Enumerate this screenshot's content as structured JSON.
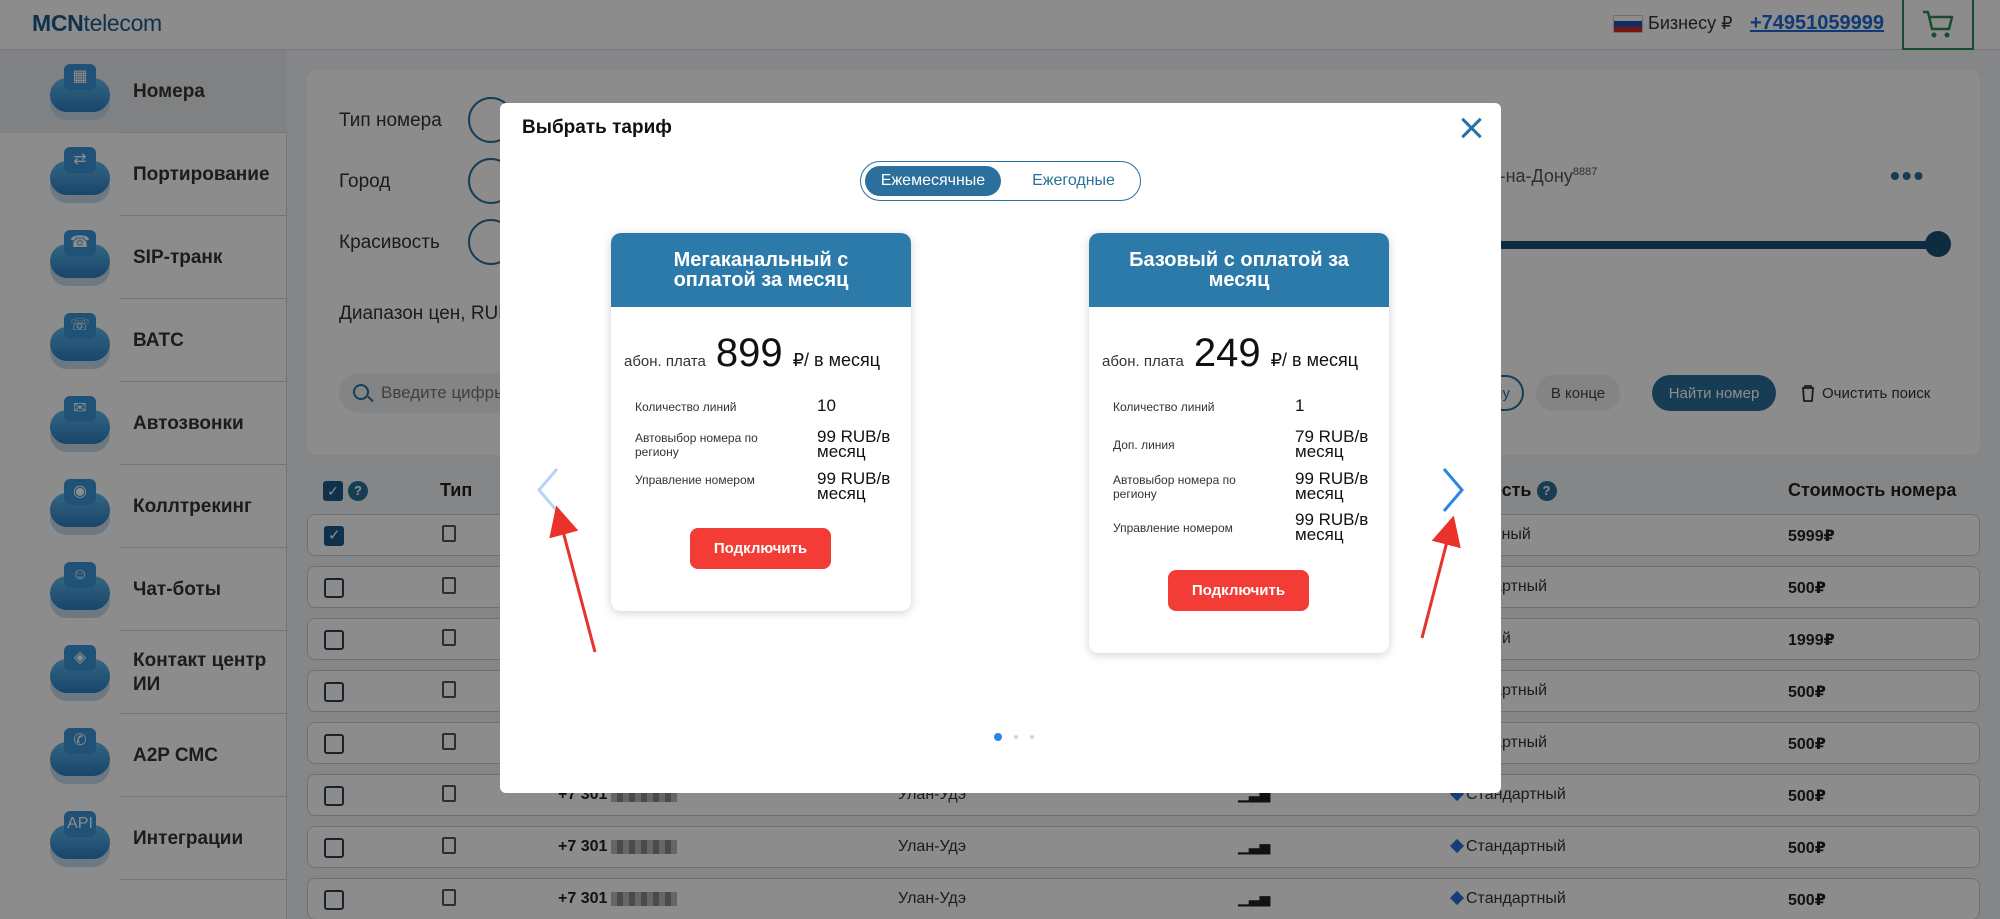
{
  "header": {
    "logo_bold": "MCN",
    "logo_rest": "telecom",
    "account_label": "Бизнесу ₽",
    "phone": "+74951059999"
  },
  "sidebar": {
    "items": [
      {
        "label": "Номера",
        "icon": "phone-numbers-icon",
        "glyph": "▦"
      },
      {
        "label": "Портирование",
        "icon": "porting-icon",
        "glyph": "⇄"
      },
      {
        "label": "SIP-транк",
        "icon": "sip-trunk-icon",
        "glyph": "☎"
      },
      {
        "label": "ВАТС",
        "icon": "vats-icon",
        "glyph": "☏"
      },
      {
        "label": "Автозвонки",
        "icon": "autocall-icon",
        "glyph": "✉"
      },
      {
        "label": "Коллтрекинг",
        "icon": "calltracking-icon",
        "glyph": "◉"
      },
      {
        "label": "Чат-боты",
        "icon": "chatbot-icon",
        "glyph": "☺"
      },
      {
        "label": "Контакт центр ИИ",
        "icon": "ai-contact-center-icon",
        "glyph": "◈"
      },
      {
        "label": "A2P СМС",
        "icon": "a2p-sms-icon",
        "glyph": "✆"
      },
      {
        "label": "Интеграции",
        "icon": "integrations-icon",
        "glyph": "API"
      }
    ]
  },
  "filters": {
    "type_label": "Тип номера",
    "city_label": "Город",
    "beauty_label": "Красивость",
    "price_range_label": "Диапазон цен, RUB",
    "city_tag": "ов-на-Дону",
    "city_tag_count": "8887",
    "search_placeholder": "Введите цифры",
    "pos_option_anywhere": "му",
    "pos_option_end": "В конце",
    "find_button": "Найти номер",
    "clear_button": "Очистить поиск"
  },
  "table": {
    "headers": {
      "type": "Тип",
      "beauty": "вость",
      "price": "Стоимость номера"
    },
    "rows": [
      {
        "number": "",
        "city": "",
        "category": "брняный",
        "price": "5999₽",
        "checked": true
      },
      {
        "number": "",
        "city": "",
        "category": "андартный",
        "price": "500₽",
        "checked": false
      },
      {
        "number": "",
        "city": "",
        "category": "зовый",
        "price": "1999₽",
        "checked": false
      },
      {
        "number": "",
        "city": "",
        "category": "андартный",
        "price": "500₽",
        "checked": false
      },
      {
        "number": "",
        "city": "",
        "category": "андартный",
        "price": "500₽",
        "checked": false
      },
      {
        "number": "+7 301",
        "city": "Улан-Удэ",
        "category": "Стандартный",
        "price": "500₽",
        "checked": false
      },
      {
        "number": "+7 301",
        "city": "Улан-Удэ",
        "category": "Стандартный",
        "price": "500₽",
        "checked": false
      },
      {
        "number": "+7 301",
        "city": "Улан-Удэ",
        "category": "Стандартный",
        "price": "500₽",
        "checked": false
      }
    ]
  },
  "modal": {
    "title": "Выбрать тариф",
    "toggle": {
      "monthly": "Ежемесячные",
      "yearly": "Ежегодные"
    },
    "fee_label": "абон. плата",
    "per_month": "₽/ в месяц",
    "connect_label": "Подключить",
    "tariffs": [
      {
        "title": "Мегаканальный с оплатой за месяц",
        "price": "899",
        "features": [
          {
            "name": "Количество линий",
            "value": "10"
          },
          {
            "name": "Автовыбор номера по региону",
            "value": "99 RUB/в месяц"
          },
          {
            "name": "Управление номером",
            "value": "99 RUB/в месяц"
          }
        ]
      },
      {
        "title": "Базовый с оплатой за месяц",
        "price": "249",
        "features": [
          {
            "name": "Количество линий",
            "value": "1"
          },
          {
            "name": "Доп. линия",
            "value": "79 RUB/в месяц"
          },
          {
            "name": "Автовыбор номера по региону",
            "value": "99 RUB/в месяц"
          },
          {
            "name": "Управление номером",
            "value": "99 RUB/в месяц"
          }
        ]
      }
    ],
    "carousel_page": 1,
    "carousel_pages": 3
  },
  "colors": {
    "brand": "#2b6f9c",
    "card_header": "#2b7aaa",
    "connect_button": "#f23c35",
    "annotation_arrow": "#e8322b",
    "nav_arrow": "#2a86e0"
  }
}
